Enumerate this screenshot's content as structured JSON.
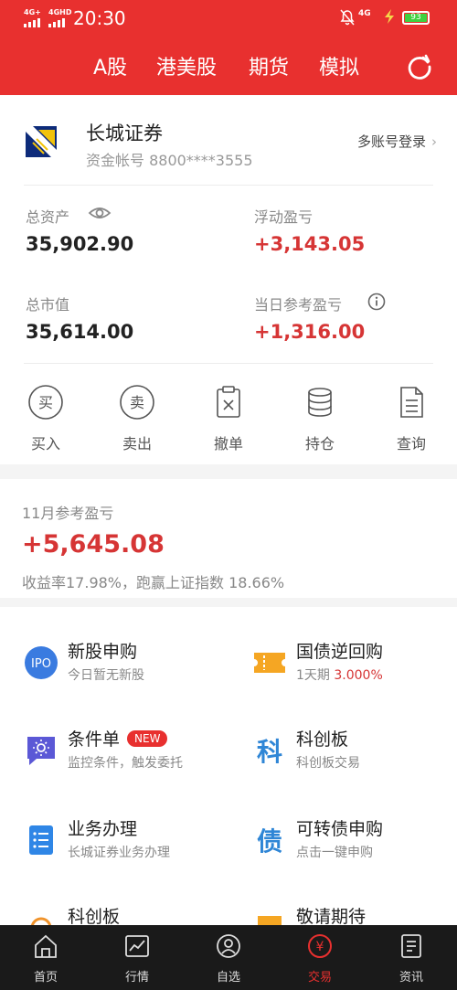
{
  "status_bar": {
    "sig1": "4G+",
    "sig2": "4GHD",
    "time": "20:30",
    "net": "4G",
    "battery": "93"
  },
  "header": {
    "tabs": [
      "A股",
      "港美股",
      "期货",
      "模拟"
    ],
    "refresh_icon": "refresh-icon"
  },
  "account": {
    "broker_name": "长城证券",
    "account_no": "资金帐号 8800****3555",
    "multi_login": "多账号登录",
    "total_assets_label": "总资产",
    "total_assets": "35,902.90",
    "float_pl_label": "浮动盈亏",
    "float_pl": "+3,143.05",
    "market_value_label": "总市值",
    "market_value": "35,614.00",
    "daily_pl_label": "当日参考盈亏",
    "daily_pl": "+1,316.00"
  },
  "actions": [
    {
      "label": "买入",
      "glyph": "买",
      "icon": "buy-icon"
    },
    {
      "label": "卖出",
      "glyph": "卖",
      "icon": "sell-icon"
    },
    {
      "label": "撤单",
      "icon": "cancel-order-icon"
    },
    {
      "label": "持仓",
      "icon": "holdings-icon"
    },
    {
      "label": "查询",
      "icon": "query-icon"
    }
  ],
  "monthly": {
    "label": "11月参考盈亏",
    "value": "+5,645.08",
    "desc": "收益率17.98%，跑赢上证指数 18.66%"
  },
  "services": {
    "ipo": {
      "title": "新股申购",
      "sub": "今日暂无新股",
      "badge": "IPO"
    },
    "repo": {
      "title": "国债逆回购",
      "sub_prefix": "1天期 ",
      "sub_rate": "3.000%"
    },
    "cond": {
      "title": "条件单",
      "badge": "NEW",
      "sub": "监控条件，触发委托"
    },
    "star": {
      "title": "科创板",
      "sub": "科创板交易",
      "glyph": "科"
    },
    "biz": {
      "title": "业务办理",
      "sub": "长城证券业务办理"
    },
    "cb": {
      "title": "可转债申购",
      "sub": "点击一键申购",
      "glyph": "债"
    },
    "star2": {
      "title": "科创板"
    },
    "soon": {
      "title": "敬请期待"
    }
  },
  "nav": {
    "items": [
      {
        "label": "首页",
        "icon": "home-icon"
      },
      {
        "label": "行情",
        "icon": "chart-icon"
      },
      {
        "label": "自选",
        "icon": "favorites-icon"
      },
      {
        "label": "交易",
        "icon": "trade-icon",
        "active": true
      },
      {
        "label": "资讯",
        "icon": "news-icon"
      }
    ]
  },
  "colors": {
    "brand_red": "#e8302f",
    "profit_red": "#d63535",
    "bg": "#f4f4f4"
  }
}
